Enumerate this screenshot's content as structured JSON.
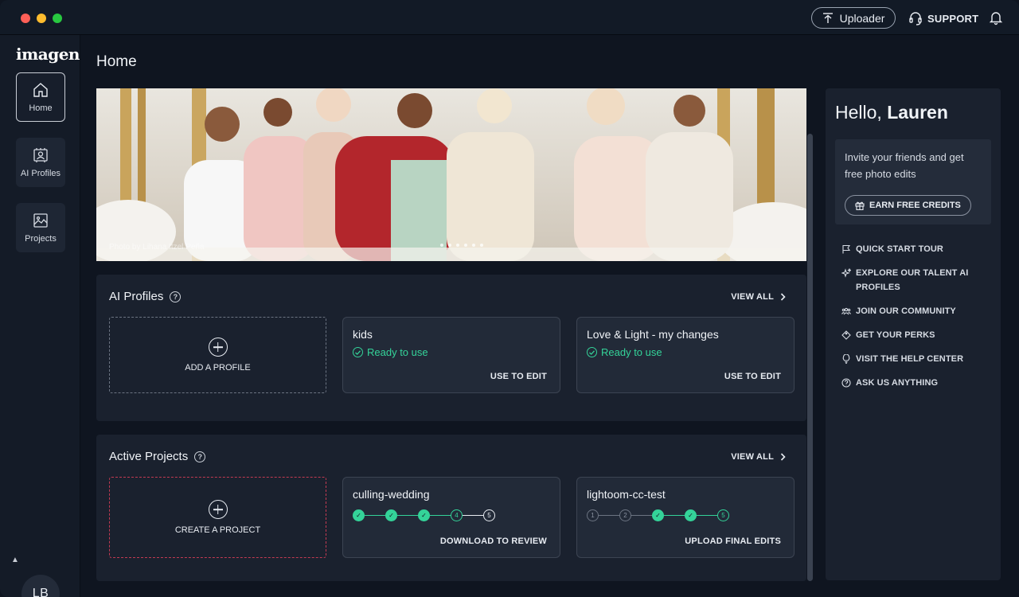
{
  "titlebar": {
    "uploader_label": "Uploader",
    "support_label": "SUPPORT"
  },
  "sidebar": {
    "logo": "imagen",
    "items": [
      {
        "label": "Home",
        "icon": "home-icon"
      },
      {
        "label": "AI Profiles",
        "icon": "ai-profile-icon"
      },
      {
        "label": "Projects",
        "icon": "projects-icon"
      }
    ],
    "avatar_initials": "LB"
  },
  "main": {
    "page_title": "Home",
    "hero": {
      "credit": "Photo by Lihana Itzel Peña",
      "dots": 6
    },
    "ai_profiles": {
      "title": "AI Profiles",
      "view_all": "VIEW ALL",
      "add_label": "ADD A PROFILE",
      "cards": [
        {
          "name": "kids",
          "status": "Ready to use",
          "action": "USE TO EDIT"
        },
        {
          "name": "Love & Light - my changes",
          "status": "Ready to use",
          "action": "USE TO EDIT"
        }
      ]
    },
    "active_projects": {
      "title": "Active Projects",
      "view_all": "VIEW ALL",
      "add_label": "CREATE A PROJECT",
      "cards": [
        {
          "name": "culling-wedding",
          "action": "DOWNLOAD TO REVIEW",
          "steps": [
            "done",
            "done",
            "done",
            "4",
            "5"
          ]
        },
        {
          "name": "lightoom-cc-test",
          "action": "UPLOAD FINAL EDITS",
          "steps": [
            "1",
            "2",
            "done",
            "done",
            "5"
          ]
        }
      ]
    }
  },
  "right_panel": {
    "greeting": "Hello,",
    "user_name": "Lauren",
    "invite_text": "Invite your friends and get free photo edits",
    "earn_button": "EARN FREE CREDITS",
    "links": [
      {
        "label": "QUICK START TOUR",
        "icon": "flag-icon"
      },
      {
        "label": "EXPLORE OUR TALENT AI PROFILES",
        "icon": "sparkle-icon"
      },
      {
        "label": "JOIN OUR COMMUNITY",
        "icon": "community-icon"
      },
      {
        "label": "GET YOUR PERKS",
        "icon": "tag-icon"
      },
      {
        "label": "VISIT THE HELP CENTER",
        "icon": "lightbulb-icon"
      },
      {
        "label": "ASK US ANYTHING",
        "icon": "question-icon"
      }
    ]
  },
  "colors": {
    "accent_green": "#34d399",
    "create_border_red": "#c23a52",
    "background": "#0f1520"
  }
}
